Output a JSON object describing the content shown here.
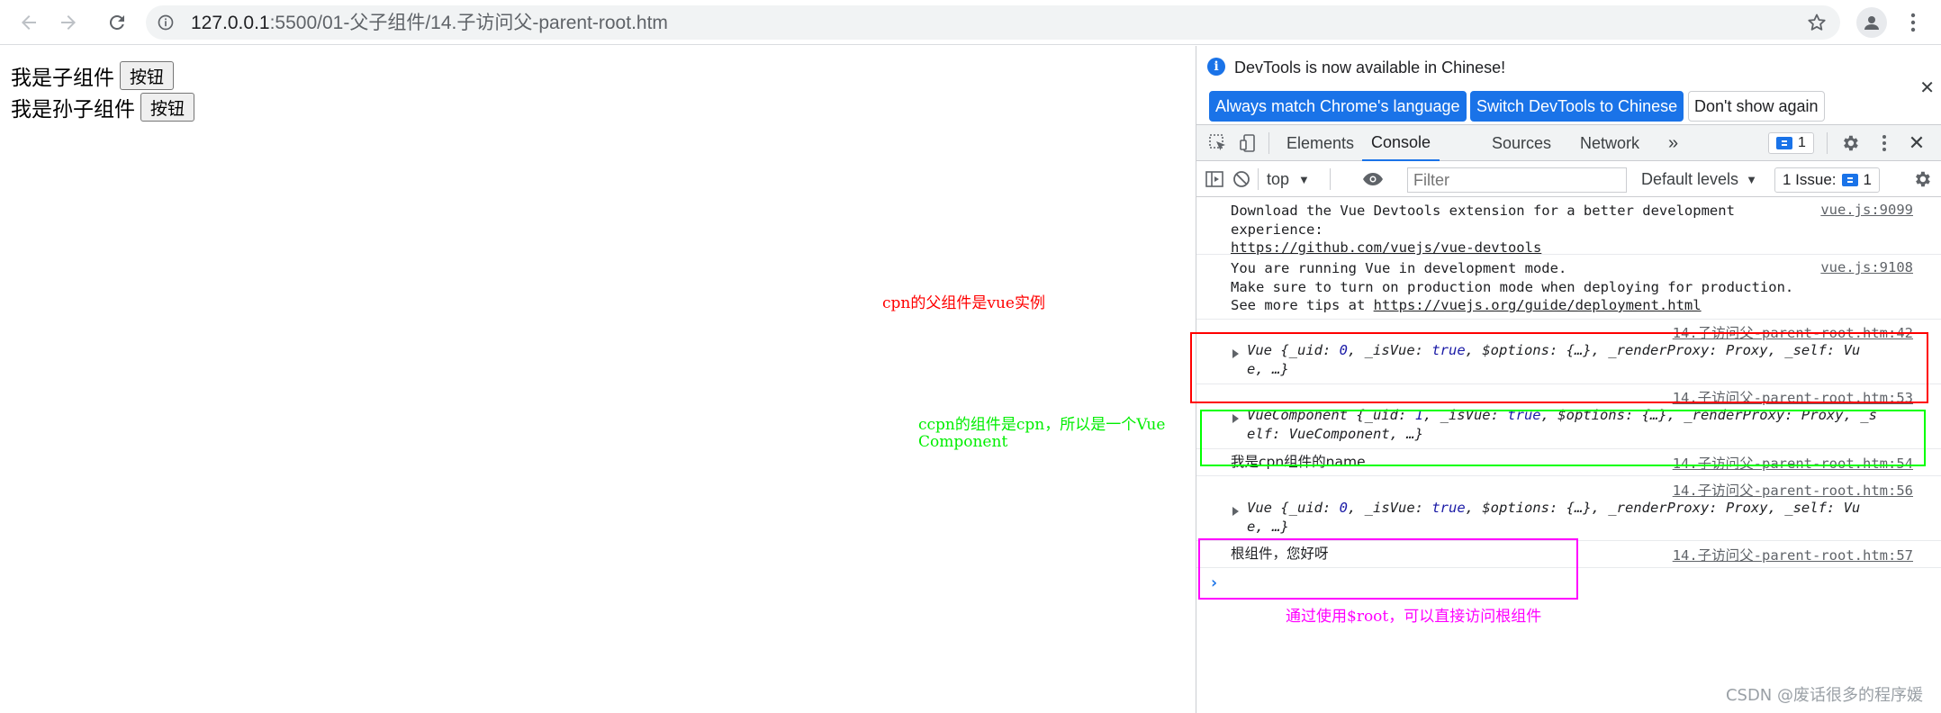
{
  "browser": {
    "url_host": "127.0.0.1",
    "url_path": ":5500/01-父子组件/14.子访问父-parent-root.htm"
  },
  "page": {
    "child_text": "我是子组件",
    "child_button": "按钮",
    "grandchild_text": "我是孙子组件",
    "grandchild_button": "按钮"
  },
  "devtools": {
    "infobar": {
      "message": "DevTools is now available in Chinese!",
      "btn_match": "Always match Chrome's language",
      "btn_switch": "Switch DevTools to Chinese",
      "btn_dont_show": "Don't show again"
    },
    "tabs": [
      "Elements",
      "Console",
      "Sources",
      "Network"
    ],
    "more_tabs": "»",
    "messages_badge": "1",
    "console_toolbar": {
      "context": "top",
      "filter_placeholder": "Filter",
      "levels": "Default levels",
      "issues_label": "1 Issue:",
      "issues_count": "1"
    },
    "entries": [
      {
        "lines": [
          "Download the Vue Devtools extension for a better development",
          "experience:"
        ],
        "link": "https://github.com/vuejs/vue-devtools",
        "source": "vue.js:9099"
      },
      {
        "lines": [
          "You are running Vue in development mode.",
          "Make sure to turn on production mode when deploying for production."
        ],
        "link_prefix": "See more tips at ",
        "link": "https://vuejs.org/guide/deployment.html",
        "source": "vue.js:9108"
      },
      {
        "obj_line1": "Vue {_uid: 0, _isVue: true, $options: {…}, _renderProxy: Proxy, _self: Vu",
        "obj_line2": "e, …}",
        "source": "14.子访问父-parent-root.htm:42"
      },
      {
        "obj_line1": "VueComponent {_uid: 1, _isVue: true, $options: {…}, _renderProxy: Proxy, _s",
        "obj_line2": "elf: VueComponent, …}",
        "source": "14.子访问父-parent-root.htm:53"
      },
      {
        "text": "我是cpn组件的name",
        "source": "14.子访问父-parent-root.htm:54"
      },
      {
        "obj_line1": "Vue {_uid: 0, _isVue: true, $options: {…}, _renderProxy: Proxy, _self: Vu",
        "obj_line2": "e, …}",
        "source": "14.子访问父-parent-root.htm:56"
      },
      {
        "text": "根组件，您好呀",
        "source": "14.子访问父-parent-root.htm:57"
      }
    ],
    "prompt": "›"
  },
  "annotations": {
    "red": "cpn的父组件是vue实例",
    "green_line1": "ccpn的组件是cpn，所以是一个Vue",
    "green_line2": "Component",
    "magenta": "通过使用$root，可以直接访问根组件"
  },
  "watermark": "CSDN @废话很多的程序媛",
  "colors": {
    "red": "#ff0000",
    "green": "#00ff00",
    "magenta": "#ff00ff",
    "accent": "#1a73e8"
  }
}
